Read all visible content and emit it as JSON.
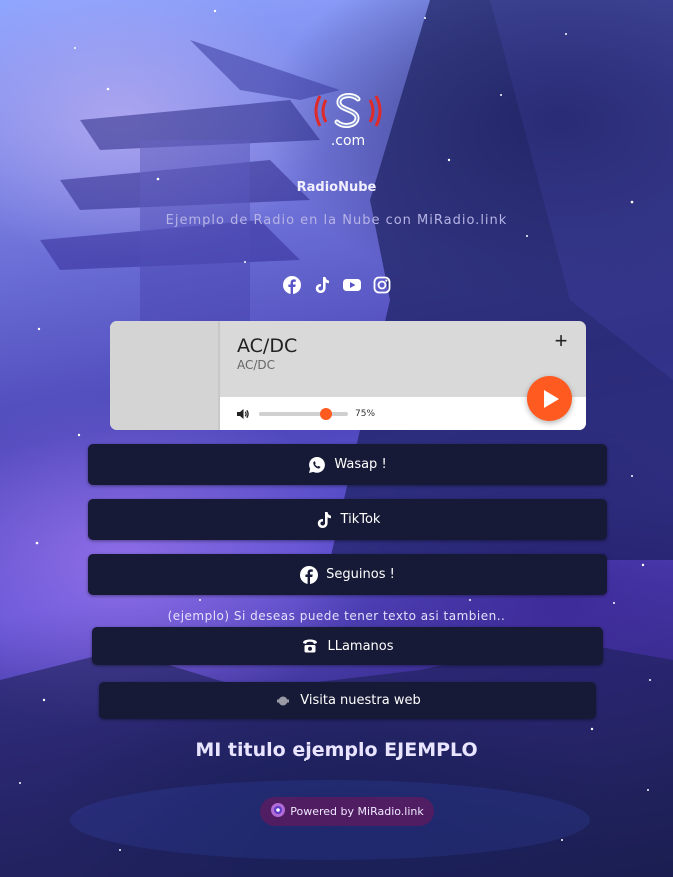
{
  "logo": {
    "subtitle": ".com",
    "accent": "#e02a2a"
  },
  "station": {
    "name": "RadioNube",
    "tagline": "Ejemplo de Radio en la Nube con MiRadio.link"
  },
  "socials": [
    {
      "icon": "facebook-icon"
    },
    {
      "icon": "tiktok-icon"
    },
    {
      "icon": "youtube-icon"
    },
    {
      "icon": "instagram-icon"
    }
  ],
  "player": {
    "title": "AC/DC",
    "artist": "AC/DC",
    "add_label": "+",
    "volume_percent_label": "75%",
    "volume_level": 0.75,
    "accent": "#ff5a1f"
  },
  "links": {
    "whatsapp": {
      "label": "Wasap !",
      "icon": "whatsapp-icon"
    },
    "tiktok": {
      "label": "TikTok",
      "icon": "tiktok-icon"
    },
    "facebook": {
      "label": "Seguinos !",
      "icon": "facebook-icon"
    },
    "phone": {
      "label": "LLamanos",
      "icon": "phone-icon"
    },
    "web": {
      "label": "Visita nuestra web",
      "icon": "web-icon"
    }
  },
  "note": "(ejemplo) Si deseas puede tener texto asi tambien..",
  "footer_title": "MI titulo ejemplo EJEMPLO",
  "powered_by": "Powered by MiRadio.link",
  "colors": {
    "button_bg": "#171a36",
    "powered_bg": "#7a1459"
  }
}
